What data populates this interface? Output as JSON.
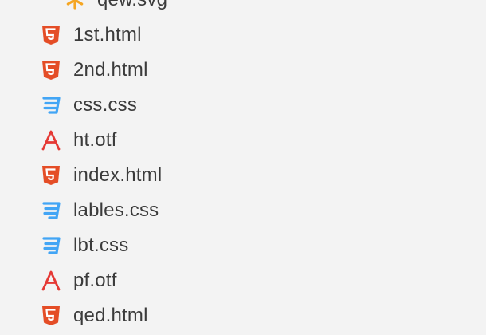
{
  "explorer": {
    "files": [
      {
        "name": "qew.svg",
        "icon": "svg-icon",
        "color": "#f5a623",
        "nested": true
      },
      {
        "name": "1st.html",
        "icon": "html5-icon",
        "color": "#e44d26"
      },
      {
        "name": "2nd.html",
        "icon": "html5-icon",
        "color": "#e44d26"
      },
      {
        "name": "css.css",
        "icon": "css3-icon",
        "color": "#42a5f5"
      },
      {
        "name": "ht.otf",
        "icon": "font-icon",
        "color": "#e53935"
      },
      {
        "name": "index.html",
        "icon": "html5-icon",
        "color": "#e44d26"
      },
      {
        "name": "lables.css",
        "icon": "css3-icon",
        "color": "#42a5f5"
      },
      {
        "name": "lbt.css",
        "icon": "css3-icon",
        "color": "#42a5f5"
      },
      {
        "name": "pf.otf",
        "icon": "font-icon",
        "color": "#e53935"
      },
      {
        "name": "qed.html",
        "icon": "html5-icon",
        "color": "#e44d26"
      }
    ]
  }
}
